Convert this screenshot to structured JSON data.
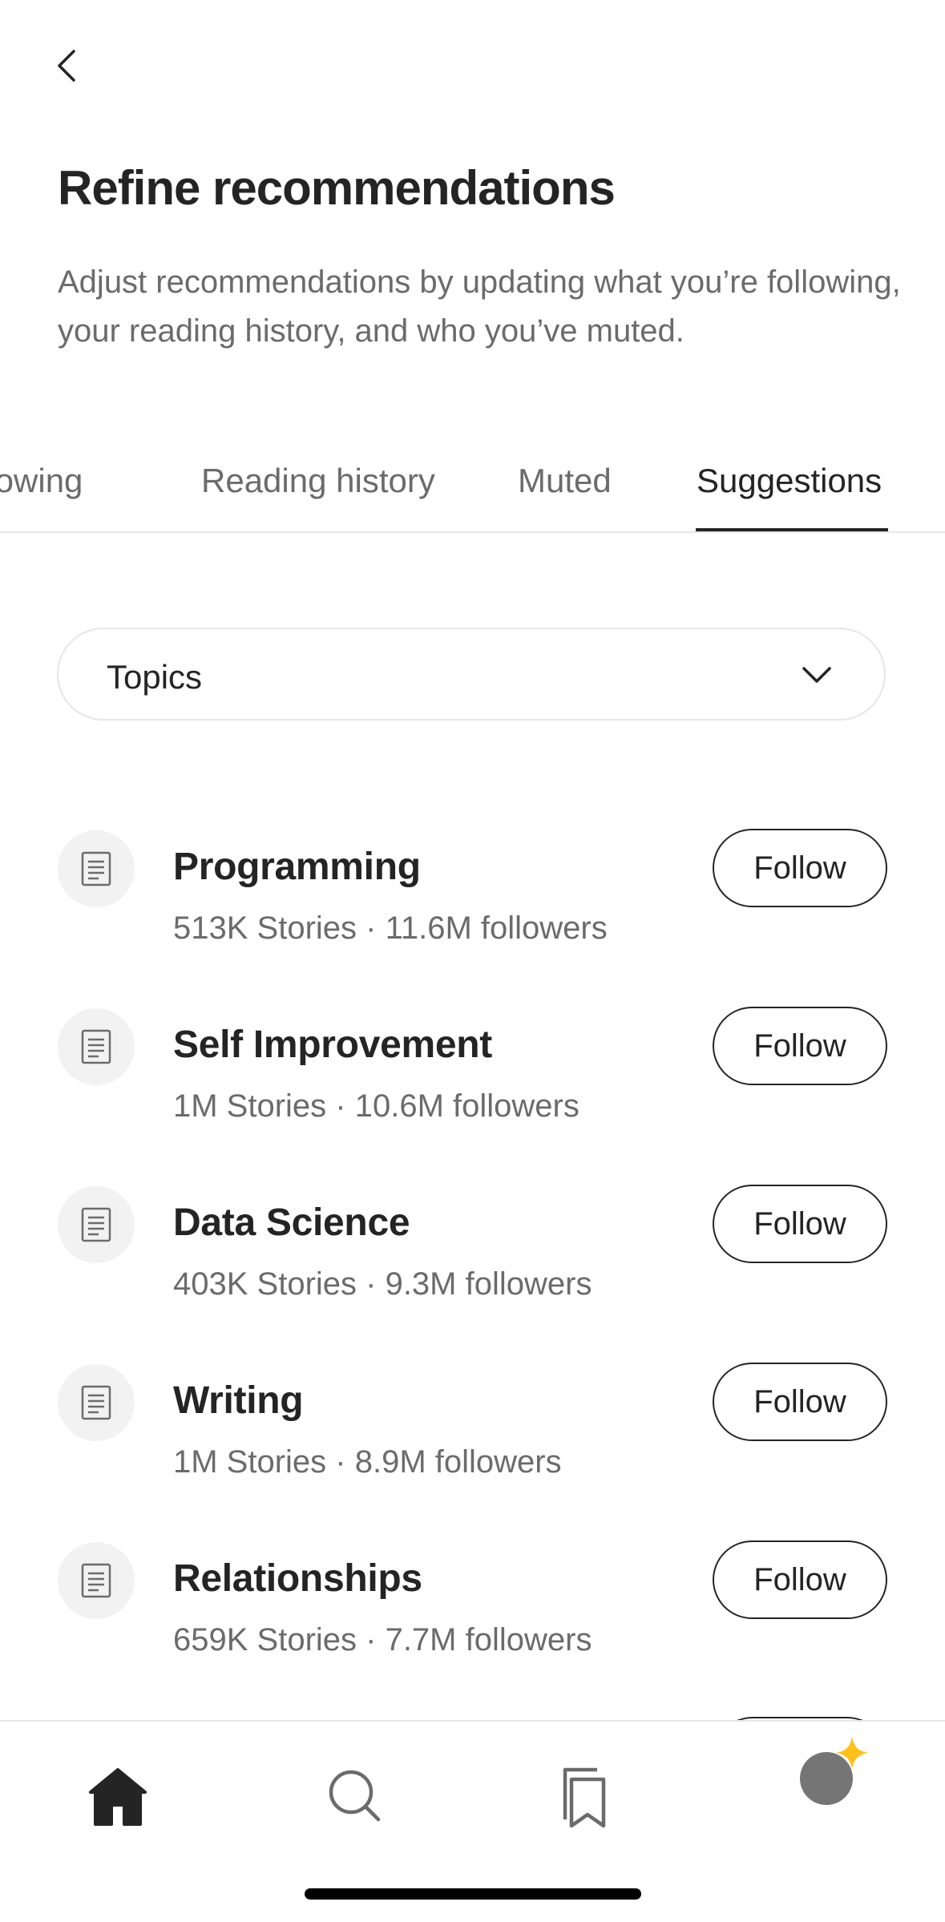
{
  "header": {
    "back_icon": "chevron-left-icon",
    "title": "Refine recommendations",
    "description": "Adjust recommendations by updating what you’re following, your reading history, and who you’ve muted."
  },
  "tabs": [
    {
      "label": "Following",
      "active": false
    },
    {
      "label": "Reading history",
      "active": false
    },
    {
      "label": "Muted",
      "active": false
    },
    {
      "label": "Suggestions",
      "active": true
    }
  ],
  "filter": {
    "selected": "Topics",
    "icon": "chevron-down-icon"
  },
  "topics": [
    {
      "name": "Programming",
      "meta": "513K Stories · 11.6M followers",
      "button": "Follow"
    },
    {
      "name": "Self Improvement",
      "meta": "1M Stories · 10.6M followers",
      "button": "Follow"
    },
    {
      "name": "Data Science",
      "meta": "403K Stories · 9.3M followers",
      "button": "Follow"
    },
    {
      "name": "Writing",
      "meta": "1M Stories · 8.9M followers",
      "button": "Follow"
    },
    {
      "name": "Relationships",
      "meta": "659K Stories · 7.7M followers",
      "button": "Follow"
    }
  ],
  "bottom_nav": {
    "items": [
      "home-icon",
      "search-icon",
      "bookmarks-icon",
      "profile-avatar"
    ],
    "active": "home-icon",
    "badge_icon": "sparkle-icon",
    "badge_color": "#FFC017"
  },
  "colors": {
    "text_primary": "#242424",
    "text_secondary": "#6B6B6B",
    "divider": "#E6E6E6",
    "icon_bg": "#F2F2F2"
  }
}
